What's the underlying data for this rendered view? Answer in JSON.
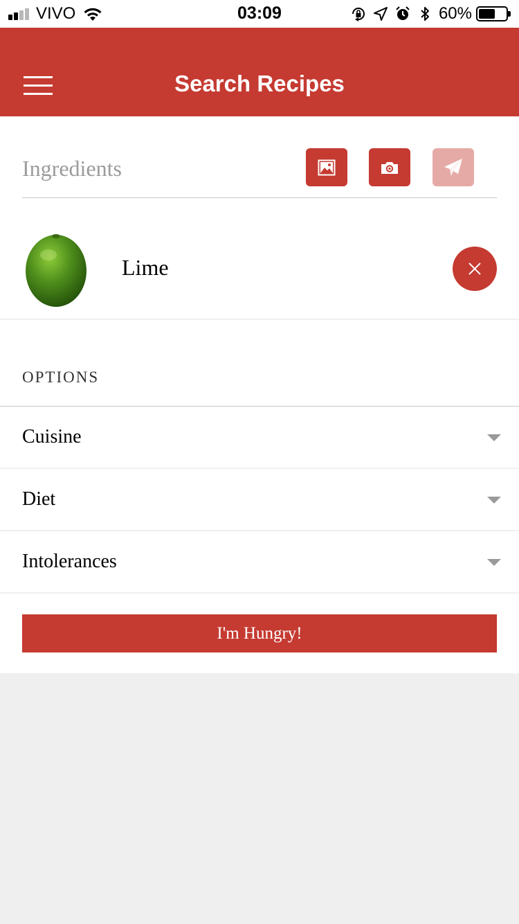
{
  "status_bar": {
    "carrier": "VIVO",
    "time": "03:09",
    "battery_percent": "60%",
    "battery_level": 0.6,
    "signal_bars_filled": 2,
    "signal_bars_total": 4,
    "icons": [
      "wifi-icon",
      "orientation-lock-icon",
      "location-arrow-icon",
      "alarm-clock-icon",
      "bluetooth-icon",
      "battery-icon"
    ]
  },
  "header": {
    "title": "Search Recipes",
    "menu_icon": "hamburger-menu-icon",
    "background_color": "#c53a31"
  },
  "ingredients": {
    "placeholder": "Ingredients",
    "value": "",
    "actions": [
      {
        "name": "gallery-button",
        "icon": "image-icon",
        "enabled": true
      },
      {
        "name": "camera-button",
        "icon": "camera-icon",
        "enabled": true
      },
      {
        "name": "send-button",
        "icon": "paper-plane-icon",
        "enabled": false
      }
    ]
  },
  "ingredient_list": [
    {
      "name": "Lime",
      "image": "lime-image",
      "remove_icon": "close-icon"
    }
  ],
  "options": {
    "label": "OPTIONS",
    "items": [
      {
        "label": "Cuisine",
        "icon": "chevron-down-icon"
      },
      {
        "label": "Diet",
        "icon": "chevron-down-icon"
      },
      {
        "label": "Intolerances",
        "icon": "chevron-down-icon"
      }
    ]
  },
  "submit": {
    "label": "I'm Hungry!"
  },
  "colors": {
    "accent": "#c53a31",
    "accent_disabled": "#e6aaa6",
    "page_background": "#efefef"
  }
}
